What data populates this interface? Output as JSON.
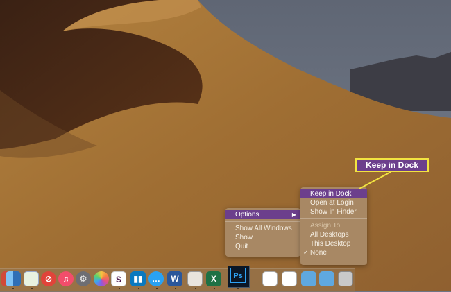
{
  "options_menu": {
    "options_label": "Options",
    "items": [
      "Show All Windows",
      "Show",
      "Quit"
    ]
  },
  "options_submenu": {
    "keep_in_dock": "Keep in Dock",
    "open_at_login": "Open at Login",
    "show_in_finder": "Show in Finder",
    "assign_to_header": "Assign To",
    "assign_options": [
      "All Desktops",
      "This Desktop",
      "None"
    ],
    "selected_assign": "None"
  },
  "callout": {
    "label": "Keep in Dock"
  },
  "dock": {
    "app_icon": "photoshop-icon",
    "app_label": "Ps",
    "icons": [
      "finder-icon",
      "maps-icon",
      "news-icon",
      "music-icon",
      "system-preferences-icon",
      "photos-icon",
      "slack-icon",
      "trello-icon",
      "messages-icon",
      "word-icon",
      "preview-icon",
      "excel-icon",
      "photoshop-icon",
      "document-icon",
      "preview-doc-icon",
      "folder-icon",
      "folder-icon",
      "image-icon",
      "trash-icon"
    ]
  },
  "colors": {
    "highlight": "#6c3f8c",
    "callout_border": "#f2e441",
    "menu_bg": "#a88864"
  }
}
